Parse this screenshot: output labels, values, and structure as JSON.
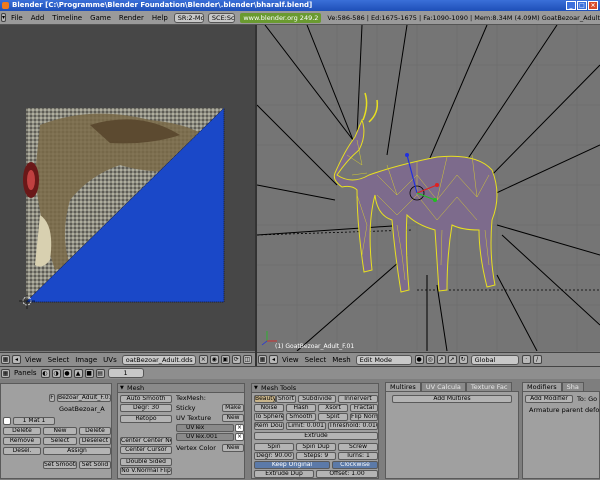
{
  "window": {
    "title": "Blender [C:\\Programme\\Blender Foundation\\Blender\\.blender\\bharalf.blend]"
  },
  "info_header": {
    "menus": [
      "File",
      "Add",
      "Timeline",
      "Game",
      "Render",
      "Help"
    ],
    "screen": "SR:2-Model",
    "scene": "SCE:Scene",
    "url": "www.blender.org 249.2",
    "stats": "Ve:586-586 | Ed:1675-1675 | Fa:1090-1090 | Mem:8.34M (4.09M) GoatBezoar_Adult"
  },
  "image_editor_header": {
    "menus": [
      "View",
      "Select",
      "Image",
      "UVs"
    ],
    "image_name": "oatBezoar_Adult.dds"
  },
  "view3d": {
    "object_label": "(1) GoatBezoar_Adult_F.01"
  },
  "view3d_header": {
    "menus": [
      "View",
      "Select",
      "Mesh"
    ],
    "mode": "Edit Mode",
    "orientation": "Global"
  },
  "buttons_window": {
    "panels_label": "Panels",
    "frame": "1",
    "link": {
      "object_name": "Bezoar_Adult_F.01",
      "object_prefix": "F",
      "mesh_name": "GoatBezoar_A",
      "mat_field": "1 Mat 1",
      "rows": [
        [
          "Delete",
          "New",
          "Delete"
        ],
        [
          "Remove",
          "Select",
          "Deselect"
        ],
        [
          "Desel.",
          "Assign",
          ""
        ]
      ],
      "set_smooth": "Set Smooth",
      "set_solid": "Set Solid"
    },
    "mesh": {
      "title": "Mesh",
      "auto_smooth": "Auto Smooth",
      "degr": "Degr: 30",
      "retopo": "Retopo",
      "center_new": "Center  Center New",
      "center_cursor": "Center Cursor",
      "double_sided": "Double Sided",
      "no_vnormal_flip": "No V.Normal Flip",
      "texmesh_label": "TexMesh:",
      "sticky_label": "Sticky",
      "make": "Make",
      "uv_texture_label": "UV Texture",
      "new": "New",
      "uvtex_items": [
        "UVTex",
        "UVTex.001"
      ],
      "vertex_color_label": "Vertex Color",
      "new2": "New"
    },
    "mesh_tools": {
      "title": "Mesh Tools",
      "rows": [
        [
          "Beauty",
          "Short",
          "Subdivide",
          "Innervert"
        ],
        [
          "Noise",
          "Hash",
          "Xsort",
          "Fractal"
        ],
        [
          "To Sphere",
          "Smooth",
          "Split",
          "Flip Normal"
        ]
      ],
      "rem_doubles": "Rem Doubles",
      "limit": "Limit: 0.001",
      "threshold": "Threshold: 0.010",
      "extrude": "Extrude",
      "spin": "Spin",
      "spin_dup": "Spin Dup",
      "screw": "Screw",
      "degr": "Degr: 90.00",
      "steps": "Steps: 9",
      "turns": "Turns: 1",
      "keep_original": "Keep Original",
      "clockwise": "Clockwise",
      "extrude_dup": "Extrude Dup",
      "offset": "Offset: 1.00"
    },
    "multires": {
      "tabs": [
        "Multires",
        "UV Calcula",
        "Texture Fac"
      ],
      "add_multires": "Add Multires"
    },
    "modifiers": {
      "title": "Modifiers",
      "tab2": "Sha",
      "add_modifier": "Add Modifier",
      "to_label": "To: Go",
      "armature_text": "Armature parent deform"
    }
  }
}
